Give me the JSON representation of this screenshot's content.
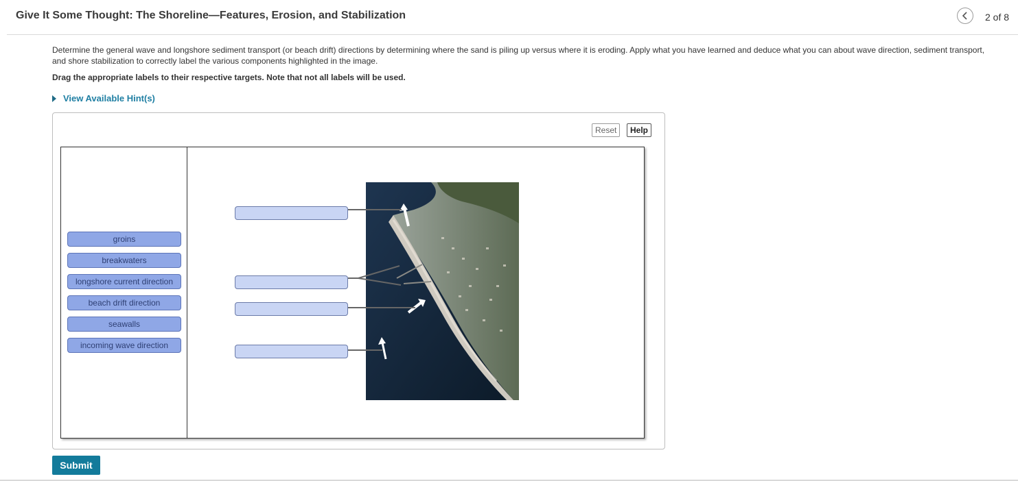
{
  "header": {
    "title": "Give It Some Thought: The Shoreline—Features, Erosion, and Stabilization",
    "page_counter": "2 of 8"
  },
  "instructions": {
    "text": "Determine the general wave and longshore sediment transport (or beach drift) directions by determining where the sand is piling up versus where it is eroding. Apply what you have learned and deduce what you can about wave direction, sediment transport, and shore stabilization to correctly label the various components highlighted in the image.",
    "drag_note": "Drag the appropriate labels to their respective targets. Note that not all labels will be used."
  },
  "hint": {
    "label": "View Available Hint(s)"
  },
  "toolbar": {
    "reset_label": "Reset",
    "help_label": "Help"
  },
  "labels": [
    "groins",
    "breakwaters",
    "longshore current direction",
    "beach drift direction",
    "seawalls",
    "incoming wave direction"
  ],
  "submit_label": "Submit",
  "icons": {
    "back": "chevron-left-icon",
    "hint": "triangle-right-icon"
  },
  "colors": {
    "accent": "#137b9b",
    "label_chip": "#8fa7e6",
    "target": "#c9d5f4",
    "link": "#1f7fa3"
  }
}
